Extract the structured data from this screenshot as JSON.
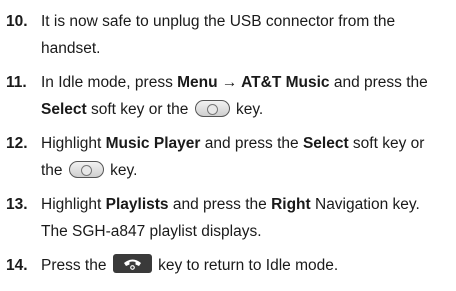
{
  "steps": [
    {
      "number": "10.",
      "lines": [
        [
          "It is now safe to unplug the USB connector from the"
        ],
        [
          "handset."
        ]
      ]
    },
    {
      "number": "11.",
      "line1": {
        "a": "In Idle mode, press ",
        "b": "Menu",
        "c": " → ",
        "d": "AT&T Music",
        "e": " and press the"
      },
      "line2": {
        "a": "Select",
        "b": " soft key or the ",
        "c": " key."
      }
    },
    {
      "number": "12.",
      "line1": {
        "a": "Highlight ",
        "b": "Music Player",
        "c": " and press the ",
        "d": "Select",
        "e": " soft key or"
      },
      "line2": {
        "a": "the ",
        "b": " key."
      }
    },
    {
      "number": "13.",
      "line1": {
        "a": "Highlight ",
        "b": "Playlists",
        "c": " and press the ",
        "d": "Right",
        "e": " Navigation key."
      },
      "line2": {
        "a": "The SGH-a847 playlist displays."
      }
    },
    {
      "number": "14.",
      "line1": {
        "a": "Press the ",
        "b": " key to return to Idle mode."
      }
    }
  ],
  "icons": {
    "select_key": "select-center-key-icon",
    "end_key": "end-power-key-icon"
  }
}
